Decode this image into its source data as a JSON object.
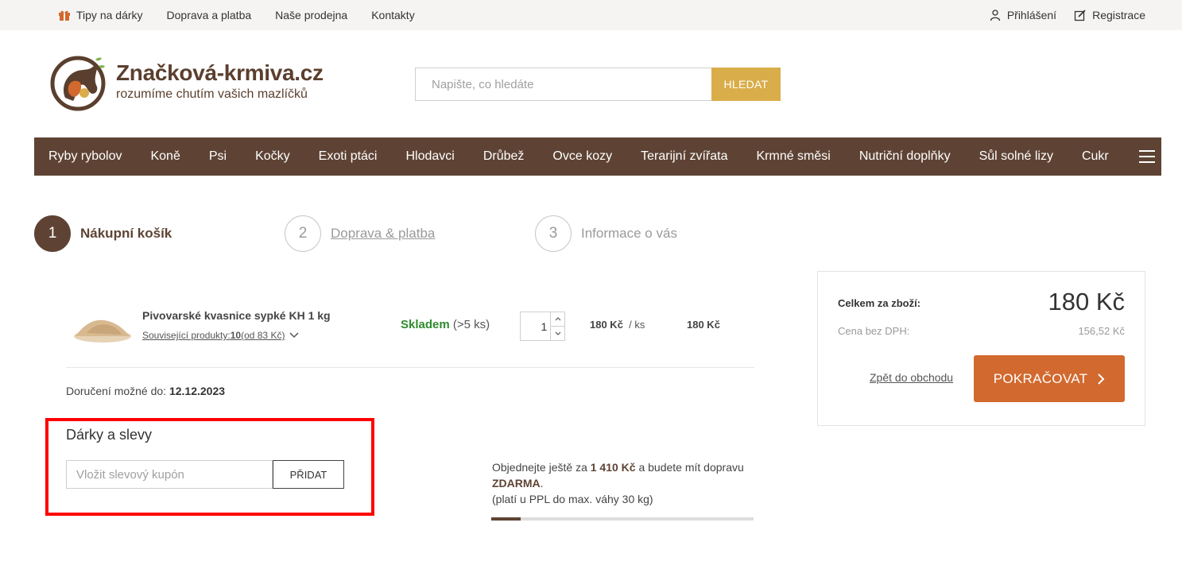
{
  "topbar": {
    "links": [
      "Tipy na dárky",
      "Doprava a platba",
      "Naše prodejna",
      "Kontakty"
    ],
    "login": "Přihlášení",
    "register": "Registrace"
  },
  "logo": {
    "name": "Značková-krmiva.cz",
    "tagline": "rozumíme chutím vašich mazlíčků"
  },
  "search": {
    "placeholder": "Napište, co hledáte",
    "button": "HLEDAT"
  },
  "nav": {
    "items": [
      "Ryby rybolov",
      "Koně",
      "Psi",
      "Kočky",
      "Exoti ptáci",
      "Hlodavci",
      "Drůbež",
      "Ovce kozy",
      "Terarijní zvířata",
      "Krmné směsi",
      "Nutriční doplňky",
      "Sůl solné lizy",
      "Cukr"
    ]
  },
  "steps": [
    {
      "num": "1",
      "label": "Nákupní košík"
    },
    {
      "num": "2",
      "label": "Doprava & platba"
    },
    {
      "num": "3",
      "label": "Informace o vás"
    }
  ],
  "cart": {
    "items": [
      {
        "name": "Pivovarské kvasnice sypké KH 1 kg",
        "related_prefix": "Související produkty: ",
        "related_count": "10",
        "related_suffix": " (od 83 Kč)",
        "stock_status": "Skladem",
        "stock_qty": "(>5 ks)",
        "quantity": "1",
        "unit_price": "180 Kč",
        "unit_suffix": "/ ks",
        "total": "180 Kč"
      }
    ],
    "delivery_label": "Doručení možné do:",
    "delivery_date": "12.12.2023"
  },
  "gifts": {
    "title": "Dárky a slevy",
    "coupon_placeholder": "Vložit slevový kupón",
    "add_button": "PŘIDAT"
  },
  "shipping": {
    "prefix": "Objednejte ještě za ",
    "amount": "1 410 Kč",
    "middle": " a budete mít dopravu ",
    "free": "ZDARMA",
    "end": ".",
    "note": "(platí u PPL do max. váhy 30 kg)",
    "progress_fraction": 0.113
  },
  "summary": {
    "total_label": "Celkem za zboží:",
    "total": "180 Kč",
    "net_label": "Cena bez DPH:",
    "net": "156,52 Kč",
    "back_link": "Zpět do obchodu",
    "continue_button": "POKRAČOVAT"
  },
  "colors": {
    "brand_brown": "#5e4334",
    "search_gold": "#d9ad4a",
    "continue_orange": "#d2692e",
    "in_stock_green": "#2e8b2e",
    "highlight_red": "#ff0000"
  },
  "icons": [
    "gift-icon",
    "user-icon",
    "edit-icon",
    "menu-icon",
    "chevron-down-icon",
    "chevron-right-icon"
  ]
}
